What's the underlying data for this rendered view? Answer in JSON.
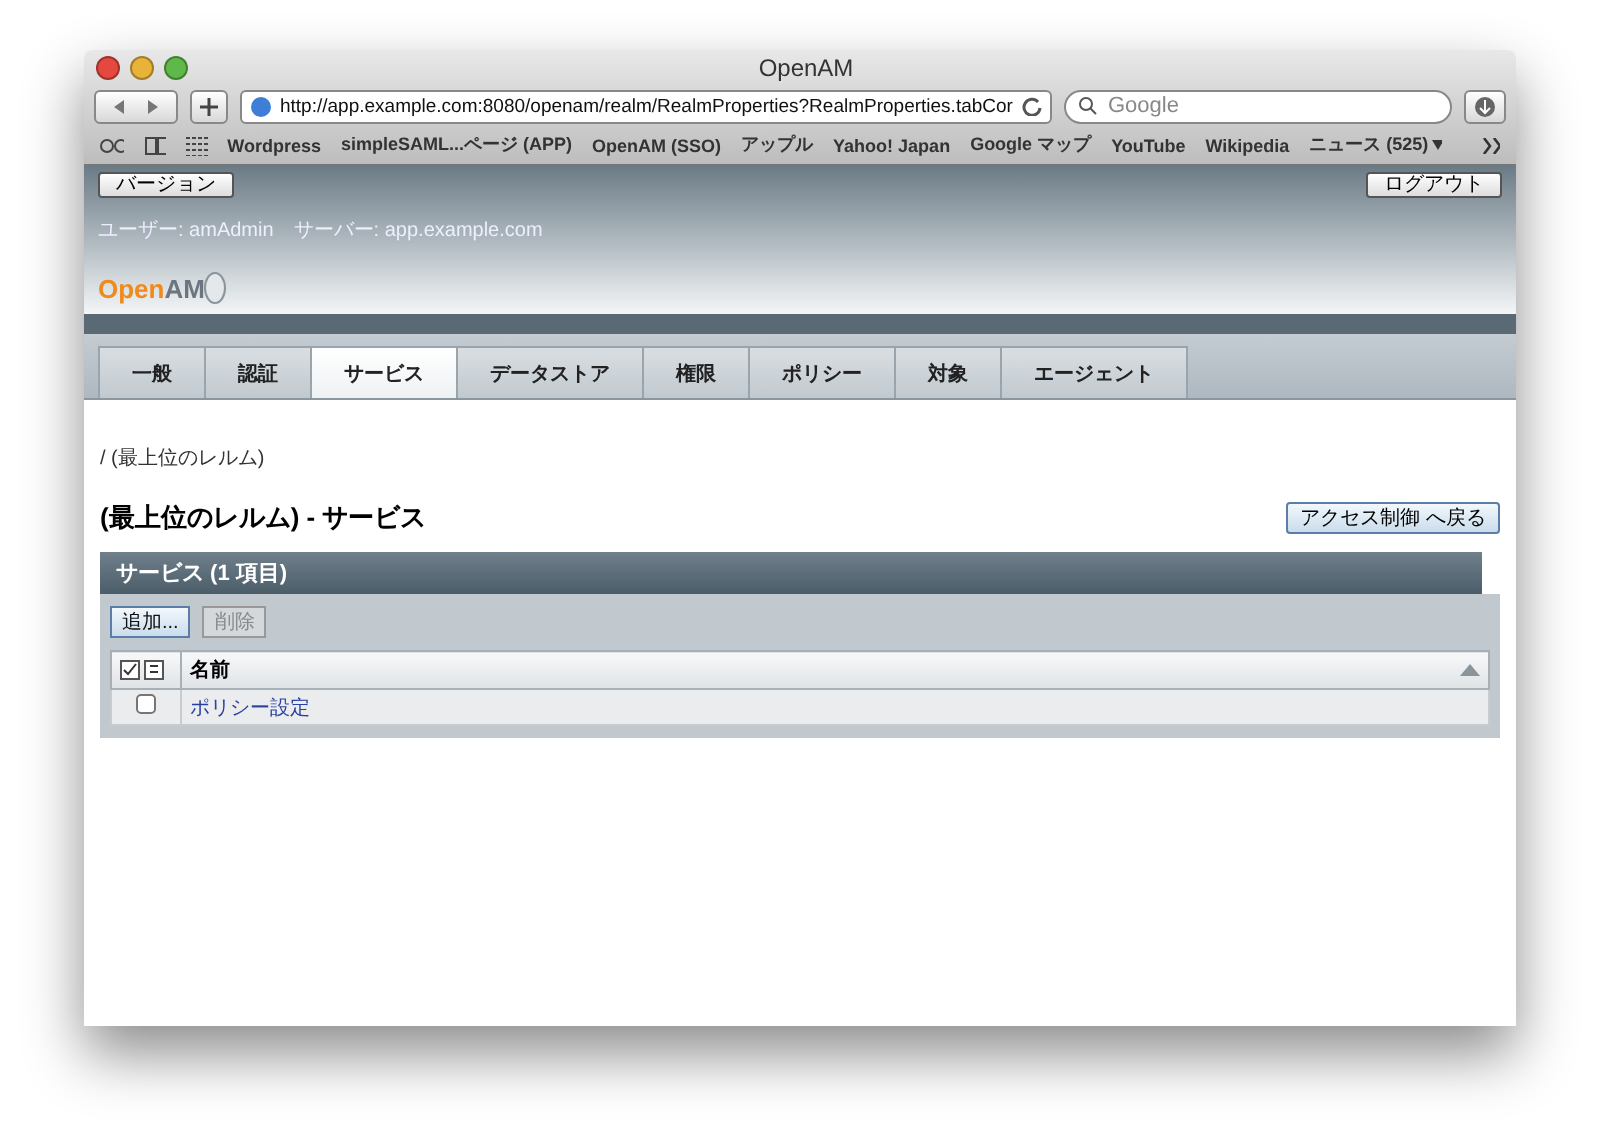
{
  "window": {
    "title": "OpenAM"
  },
  "toolbar": {
    "url": "http://app.example.com:8080/openam/realm/RealmProperties?RealmProperties.tabCor",
    "search_placeholder": "Google"
  },
  "bookmarks": [
    "Wordpress",
    "simpleSAML...ページ (APP)",
    "OpenAM (SSO)",
    "アップル",
    "Yahoo! Japan",
    "Google マップ",
    "YouTube",
    "Wikipedia",
    "ニュース (525)"
  ],
  "header": {
    "version_button": "バージョン",
    "logout_button": "ログアウト",
    "user": "ユーザー: amAdmin",
    "server": "サーバー: app.example.com",
    "logo": {
      "open": "Open",
      "am": "AM"
    }
  },
  "tabs": [
    {
      "label": "一般",
      "selected": false
    },
    {
      "label": "認証",
      "selected": false
    },
    {
      "label": "サービス",
      "selected": true
    },
    {
      "label": "データストア",
      "selected": false
    },
    {
      "label": "権限",
      "selected": false
    },
    {
      "label": "ポリシー",
      "selected": false
    },
    {
      "label": "対象",
      "selected": false
    },
    {
      "label": "エージェント",
      "selected": false
    }
  ],
  "breadcrumb": "/ (最上位のレルム)",
  "page_title": "(最上位のレルム) - サービス",
  "back_button": "アクセス制御 へ戻る",
  "table": {
    "title": "サービス (1 項目)",
    "buttons": [
      {
        "label": "追加...",
        "disabled": false
      },
      {
        "label": "削除",
        "disabled": true
      }
    ],
    "columns": [
      "名前"
    ],
    "rows": [
      {
        "name": "ポリシー設定",
        "checked": false
      }
    ]
  }
}
